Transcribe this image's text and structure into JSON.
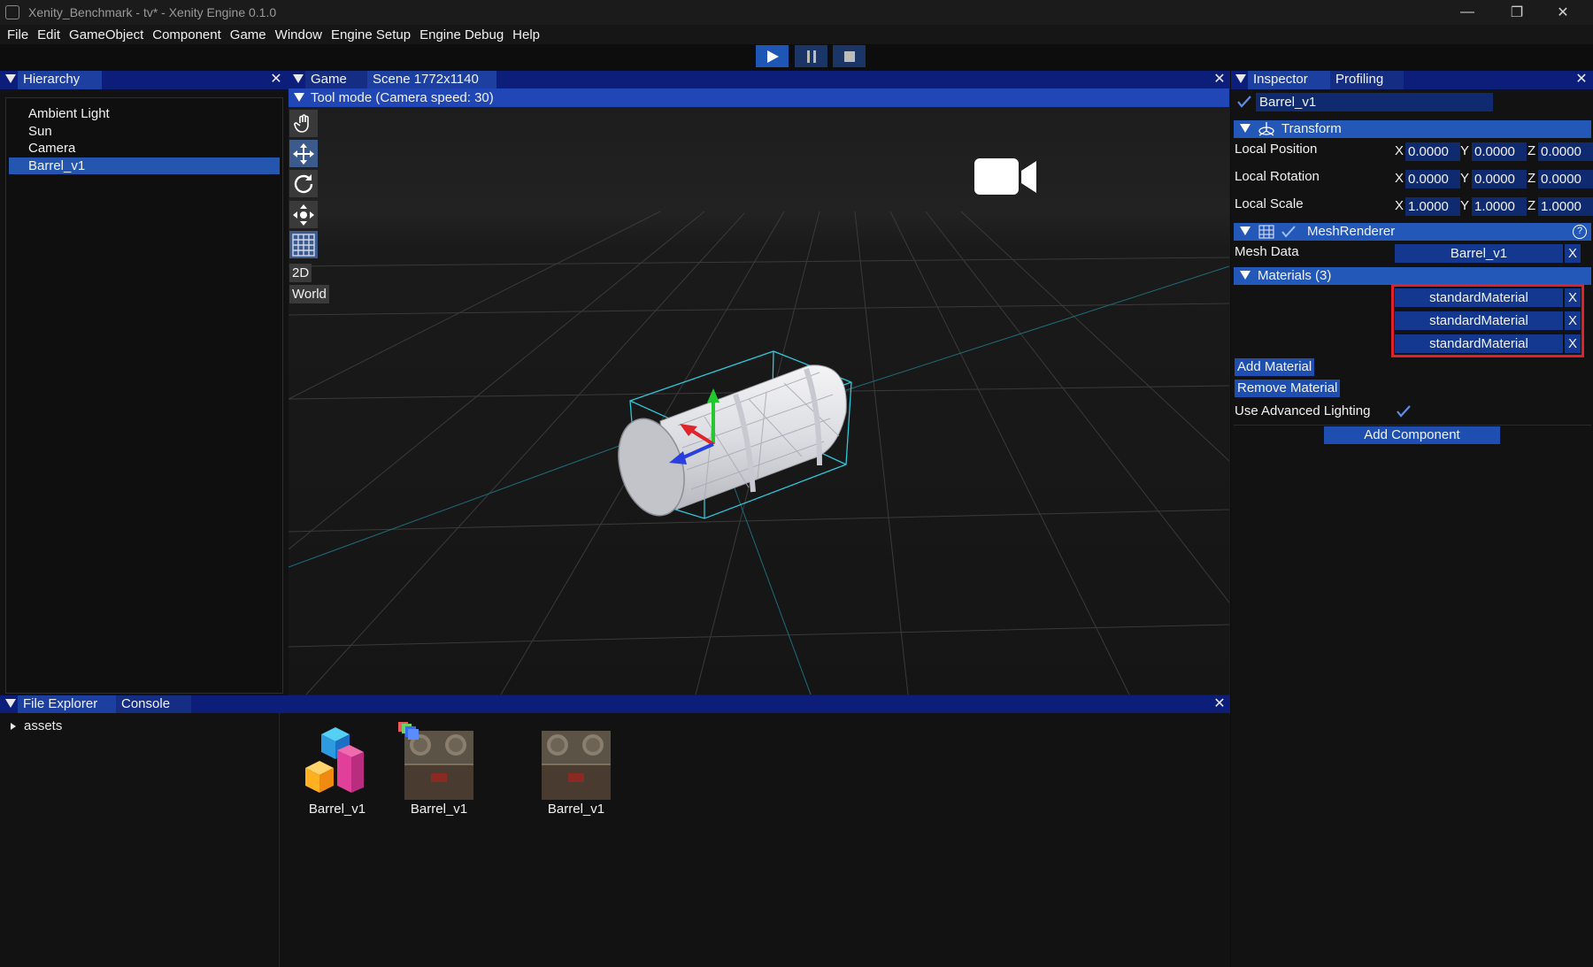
{
  "window": {
    "title": "Xenity_Benchmark - tv* - Xenity Engine 0.1.0",
    "minimize_glyph": "—",
    "restore_glyph": "❐",
    "close_glyph": "✕"
  },
  "menu": [
    "File",
    "Edit",
    "GameObject",
    "Component",
    "Game",
    "Window",
    "Engine Setup",
    "Engine Debug",
    "Help"
  ],
  "playback": {
    "play": "play-icon",
    "pause": "pause-icon",
    "stop": "stop-icon"
  },
  "hierarchy": {
    "tab": "Hierarchy",
    "items": [
      "Ambient Light",
      "Sun",
      "Camera",
      "Barrel_v1"
    ],
    "selected": "Barrel_v1"
  },
  "viewport": {
    "tabs": [
      "Game",
      "Scene 1772x1140"
    ],
    "tool_mode": "Tool mode (Camera speed: 30)",
    "tools": [
      "hand-icon",
      "move-icon",
      "rotate-icon",
      "scale-icon",
      "grid-icon"
    ],
    "mode_2d": "2D",
    "space": "World"
  },
  "inspector": {
    "tabs": [
      "Inspector",
      "Profiling"
    ],
    "object_name": "Barrel_v1",
    "transform": {
      "title": "Transform",
      "rows": [
        {
          "label": "Local Position",
          "x": "0.0000",
          "y": "0.0000",
          "z": "0.0000"
        },
        {
          "label": "Local Rotation",
          "x": "0.0000",
          "y": "0.0000",
          "z": "0.0000"
        },
        {
          "label": "Local Scale",
          "x": "1.0000",
          "y": "1.0000",
          "z": "1.0000"
        }
      ],
      "axis_x": "X",
      "axis_y": "Y",
      "axis_z": "Z"
    },
    "mesh_renderer": {
      "title": "MeshRenderer",
      "help": "?",
      "mesh_data_label": "Mesh Data",
      "mesh_data_value": "Barrel_v1",
      "materials_title": "Materials (3)",
      "materials": [
        "standardMaterial",
        "standardMaterial",
        "standardMaterial"
      ],
      "clear": "X",
      "add_material": "Add Material",
      "remove_material": "Remove Material",
      "advanced_lighting_label": "Use Advanced Lighting",
      "advanced_lighting": true
    },
    "add_component": "Add Component",
    "highlight_color": "#e0202a"
  },
  "file_explorer": {
    "tabs": [
      "File Explorer",
      "Console"
    ],
    "tree": [
      {
        "label": "assets",
        "expanded": false
      }
    ],
    "assets": [
      {
        "name": "Barrel_v1",
        "kind": "mesh"
      },
      {
        "name": "Barrel_v1",
        "kind": "material"
      },
      {
        "name": "Barrel_v1",
        "kind": "texture"
      }
    ]
  },
  "colors": {
    "tab_bar": "#0c1d7a",
    "accent": "#2357b8",
    "selection": "#2456b0",
    "gizmo_bbox": "#2fc7d8"
  }
}
